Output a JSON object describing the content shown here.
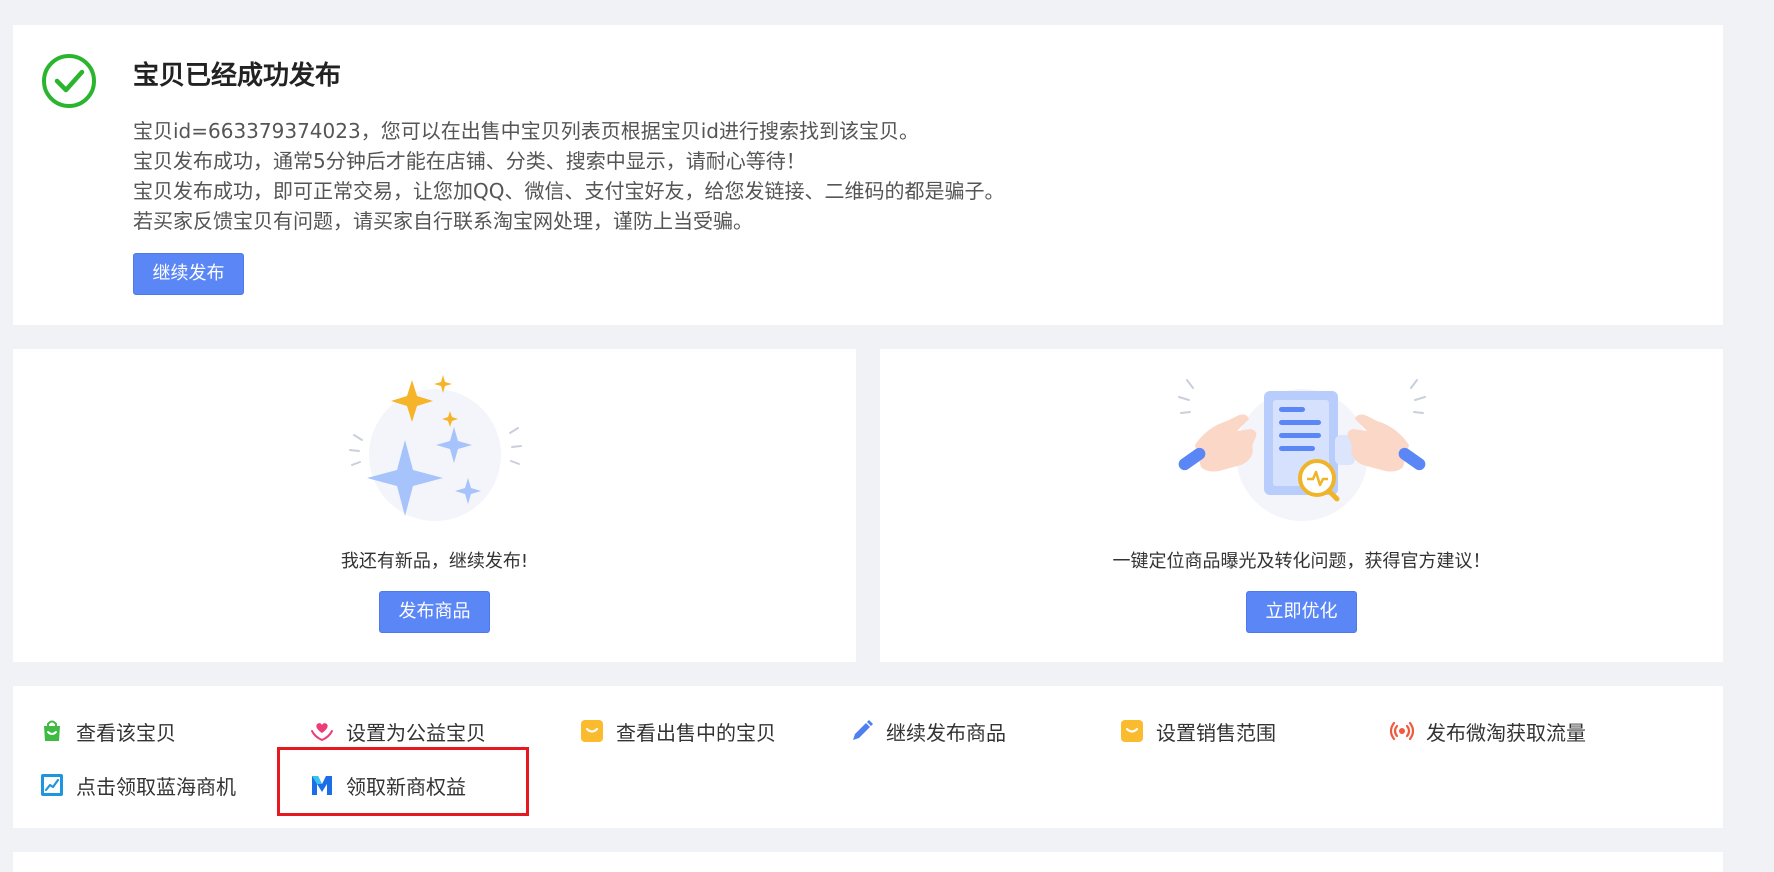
{
  "success": {
    "title": "宝贝已经成功发布",
    "lines": [
      "宝贝id=663379374023，您可以在出售中宝贝列表页根据宝贝id进行搜索找到该宝贝。",
      "宝贝发布成功，通常5分钟后才能在店铺、分类、搜索中显示，请耐心等待！",
      "宝贝发布成功，即可正常交易，让您加QQ、微信、支付宝好友，给您发链接、二维码的都是骗子。",
      "若买家反馈宝贝有问题，请买家自行联系淘宝网处理，谨防上当受骗。"
    ],
    "continue_button": "继续发布",
    "icon": "check-circle-icon",
    "icon_color": "#2bb52e"
  },
  "promo_left": {
    "text": "我还有新品，继续发布!",
    "button": "发布商品",
    "illustration": "sparkles-illustration"
  },
  "promo_right": {
    "text": "一键定位商品曝光及转化问题，获得官方建议！",
    "button": "立即优化",
    "illustration": "document-search-illustration"
  },
  "quick_links": [
    {
      "label": "查看该宝贝",
      "icon": "shopping-bag-icon"
    },
    {
      "label": "设置为公益宝贝",
      "icon": "heart-hands-icon"
    },
    {
      "label": "查看出售中的宝贝",
      "icon": "shopping-bag-icon"
    },
    {
      "label": "继续发布商品",
      "icon": "pencil-icon"
    },
    {
      "label": "设置销售范围",
      "icon": "shopping-bag-icon"
    },
    {
      "label": "发布微淘获取流量",
      "icon": "broadcast-icon"
    },
    {
      "label": "点击领取蓝海商机",
      "icon": "chart-icon"
    },
    {
      "label": "领取新商权益",
      "icon": "m-logo-icon"
    }
  ],
  "colors": {
    "primary_button": "#5b86f5",
    "highlight_border": "#e6191e",
    "page_background": "#f0f2f6"
  }
}
